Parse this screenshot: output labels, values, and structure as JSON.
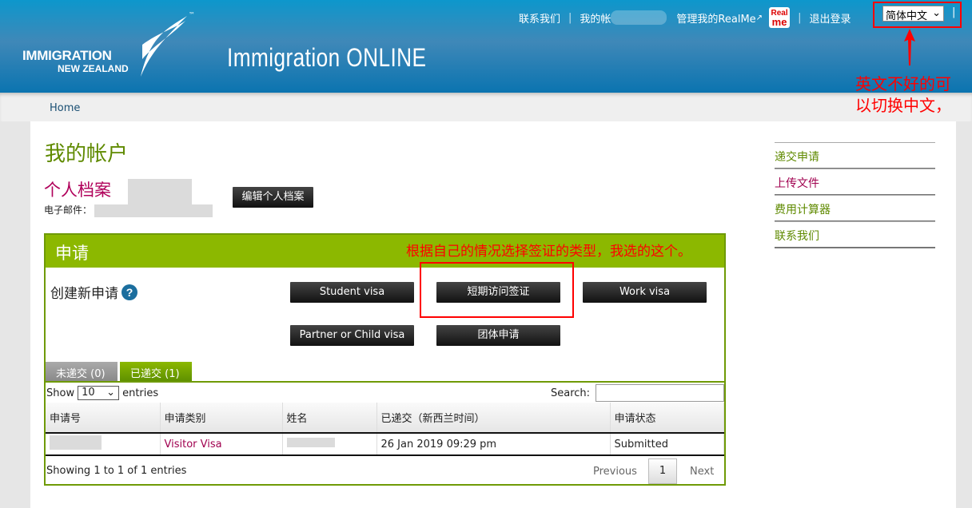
{
  "header": {
    "logo_line1": "IMMIGRATION",
    "logo_line2": "NEW ZEALAND",
    "app_title": "Immigration ONLINE",
    "nav": {
      "contact": "联系我们",
      "my_account": "我的帐",
      "manage_realme": "管理我的RealMe",
      "realme_badge_top": "Real",
      "realme_badge_bottom": "me",
      "logout": "退出登录",
      "language": "简体中文"
    }
  },
  "breadcrumb": {
    "home": "Home"
  },
  "page": {
    "title": "我的帐户",
    "profile_title": "个人档案",
    "email_label": "电子邮件：",
    "edit_profile": "编辑个人档案"
  },
  "applications": {
    "title": "申请",
    "create_label": "创建新申请",
    "help": "?",
    "buttons": [
      "Student visa",
      "短期访问签证",
      "Work visa",
      "Partner or Child visa",
      "团体申请"
    ],
    "tabs": {
      "unsubmitted": "未递交 (0)",
      "submitted": "已递交 (1)"
    },
    "show": "Show",
    "entries": "entries",
    "page_size": "10",
    "search_label": "Search:",
    "columns": [
      "申请号",
      "申请类别",
      "姓名",
      "已递交（新西兰时间）",
      "申请状态"
    ],
    "rows": [
      {
        "type": "Visitor Visa",
        "submitted": "26 Jan 2019 09:29 pm",
        "status": "Submitted"
      }
    ],
    "info": "Showing 1 to 1 of 1 entries",
    "prev": "Previous",
    "page": "1",
    "next": "Next"
  },
  "sidebar": [
    "递交申请",
    "上传文件",
    "费用计算器",
    "联系我们"
  ],
  "annotations": {
    "lang_note_1": "英文不好的可",
    "lang_note_2": "以切换中文，",
    "visa_note": "根据自己的情况选择签证的类型，我选的这个。"
  },
  "colors": {
    "brand_green": "#8cb800",
    "header_blue": "#0b74b0",
    "accent_magenta": "#b0005a"
  }
}
